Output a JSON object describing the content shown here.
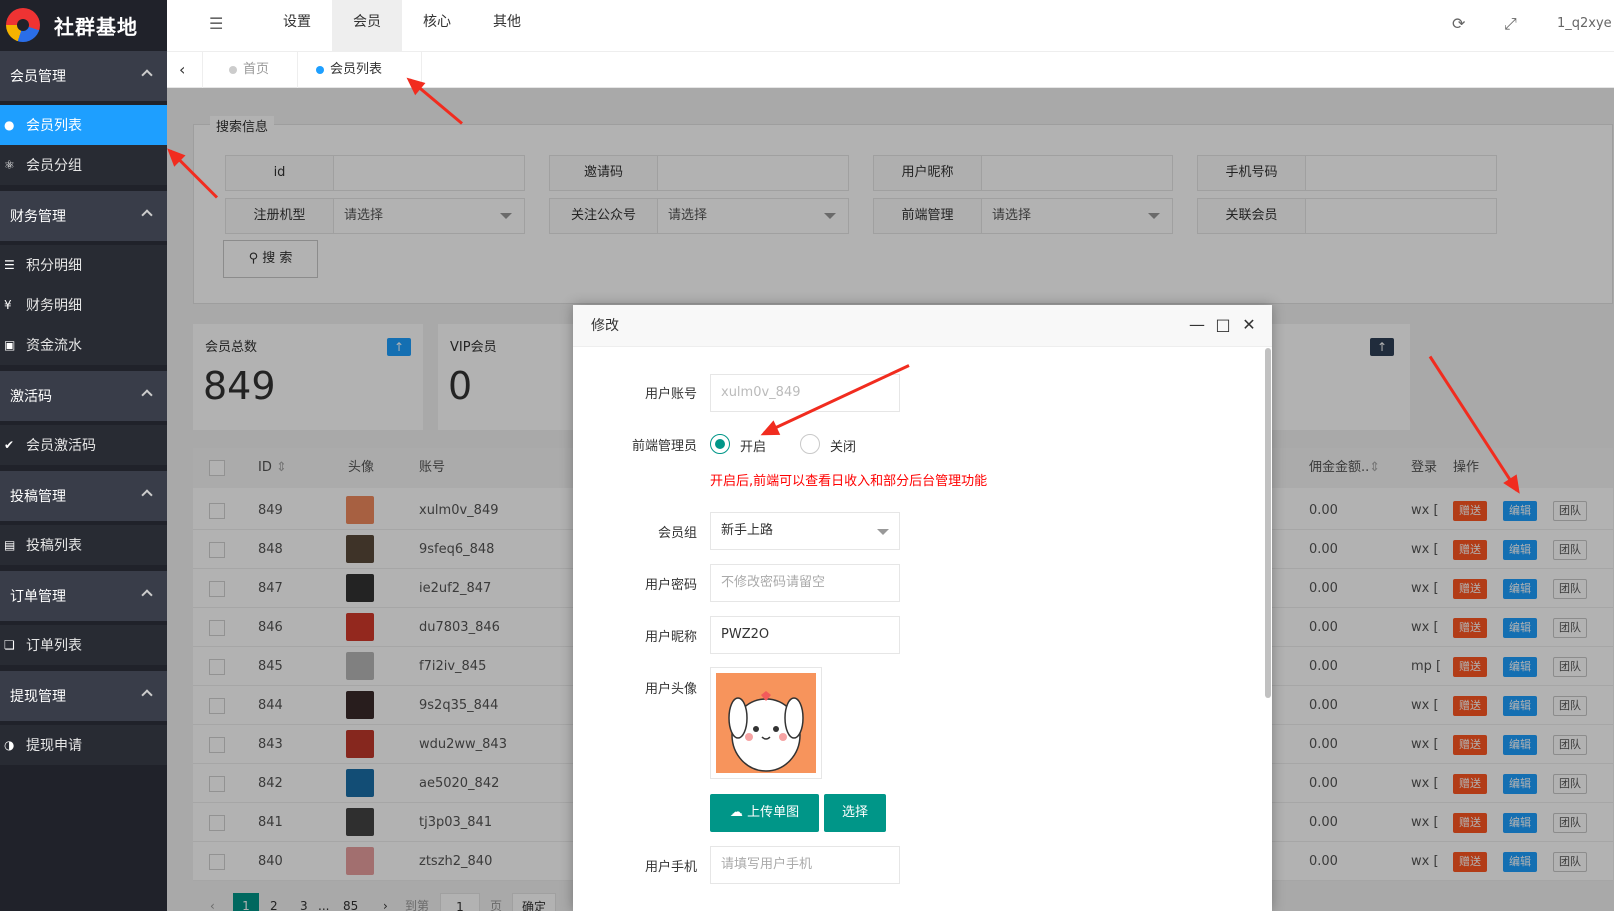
{
  "brand": {
    "name": "社群基地"
  },
  "sidebar": {
    "groups": [
      {
        "label": "会员管理",
        "items": [
          {
            "label": "会员列表",
            "icon": "user-icon",
            "active": true
          },
          {
            "label": "会员分组",
            "icon": "group-icon"
          }
        ]
      },
      {
        "label": "财务管理",
        "items": [
          {
            "label": "积分明细",
            "icon": "database-icon"
          },
          {
            "label": "财务明细",
            "icon": "yen-icon"
          },
          {
            "label": "资金流水",
            "icon": "flow-icon"
          }
        ]
      },
      {
        "label": "激活码",
        "items": [
          {
            "label": "会员激活码",
            "icon": "check-icon"
          }
        ]
      },
      {
        "label": "投稿管理",
        "items": [
          {
            "label": "投稿列表",
            "icon": "list-icon"
          }
        ]
      },
      {
        "label": "订单管理",
        "items": [
          {
            "label": "订单列表",
            "icon": "order-icon"
          }
        ]
      },
      {
        "label": "提现管理",
        "items": [
          {
            "label": "提现申请",
            "icon": "half-circle-icon"
          }
        ]
      }
    ]
  },
  "header": {
    "nav": [
      "设置",
      "会员",
      "核心",
      "其他"
    ],
    "active_nav": "会员",
    "user": "1_q2xye"
  },
  "tabs": {
    "items": [
      "首页",
      "会员列表"
    ],
    "active": "会员列表"
  },
  "search": {
    "legend": "搜索信息",
    "fields": [
      {
        "label": "id",
        "value": ""
      },
      {
        "label": "邀请码",
        "value": ""
      },
      {
        "label": "用户昵称",
        "value": ""
      },
      {
        "label": "手机号码",
        "value": ""
      },
      {
        "label": "注册机型",
        "value": "请选择"
      },
      {
        "label": "关注公众号",
        "value": "请选择"
      },
      {
        "label": "前端管理",
        "value": "请选择"
      },
      {
        "label": "关联会员",
        "value": ""
      }
    ],
    "button": "搜 索"
  },
  "stats": [
    {
      "label": "会员总数",
      "value": "849"
    },
    {
      "label": "VIP会员",
      "value": "0"
    }
  ],
  "table": {
    "headers": {
      "id": "ID",
      "avatar": "头像",
      "account": "账号",
      "commission": "佣金金额..",
      "login": "登录",
      "actions": "操作"
    },
    "rows": [
      {
        "id": "849",
        "account": "xulm0v_849",
        "commission": "0.00",
        "login": "wx [",
        "avatar_color": "#f08a5d"
      },
      {
        "id": "848",
        "account": "9sfeq6_848",
        "commission": "0.00",
        "login": "wx [",
        "avatar_color": "#5a4a3a"
      },
      {
        "id": "847",
        "account": "ie2uf2_847",
        "commission": "0.00",
        "login": "wx [",
        "avatar_color": "#333333"
      },
      {
        "id": "846",
        "account": "du7803_846",
        "commission": "0.00",
        "login": "wx [",
        "avatar_color": "#d33a2c"
      },
      {
        "id": "845",
        "account": "f7i2iv_845",
        "commission": "0.00",
        "login": "mp [",
        "avatar_color": "#b8b8b8"
      },
      {
        "id": "844",
        "account": "9s2q35_844",
        "commission": "0.00",
        "login": "wx [",
        "avatar_color": "#3a2a2a"
      },
      {
        "id": "843",
        "account": "wdu2ww_843",
        "commission": "0.00",
        "login": "wx [",
        "avatar_color": "#c0392b"
      },
      {
        "id": "842",
        "account": "ae5020_842",
        "commission": "0.00",
        "login": "wx [",
        "avatar_color": "#1a6fa8"
      },
      {
        "id": "841",
        "account": "tj3p03_841",
        "commission": "0.00",
        "login": "wx [",
        "avatar_color": "#444444"
      },
      {
        "id": "840",
        "account": "ztszh2_840",
        "commission": "0.00",
        "login": "wx [",
        "avatar_color": "#e8a0a0"
      }
    ],
    "action_labels": [
      "赠送",
      "编辑",
      "团队"
    ]
  },
  "pager": {
    "pages": [
      "1",
      "2",
      "3",
      "...",
      "85"
    ],
    "goto": "到第",
    "page_input": "1",
    "page_unit": "页",
    "confirm": "确定"
  },
  "modal": {
    "title": "修改",
    "fields": {
      "account_label": "用户账号",
      "account_value": "xulm0v_849",
      "admin_label": "前端管理员",
      "admin_on": "开启",
      "admin_off": "关闭",
      "admin_hint": "开启后,前端可以查看日收入和部分后台管理功能",
      "group_label": "会员组",
      "group_value": "新手上路",
      "password_label": "用户密码",
      "password_placeholder": "不修改密码请留空",
      "nickname_label": "用户昵称",
      "nickname_value": "PWZ2O",
      "avatar_label": "用户头像",
      "upload_button": "上传单图",
      "choose_button": "选择",
      "phone_label": "用户手机",
      "phone_placeholder": "请填写用户手机"
    }
  },
  "colors": {
    "sidebar_bg": "#20222a",
    "accent": "#1e9fff",
    "green": "#009688",
    "danger": "#ff5722",
    "arrow": "#f12c1f"
  }
}
